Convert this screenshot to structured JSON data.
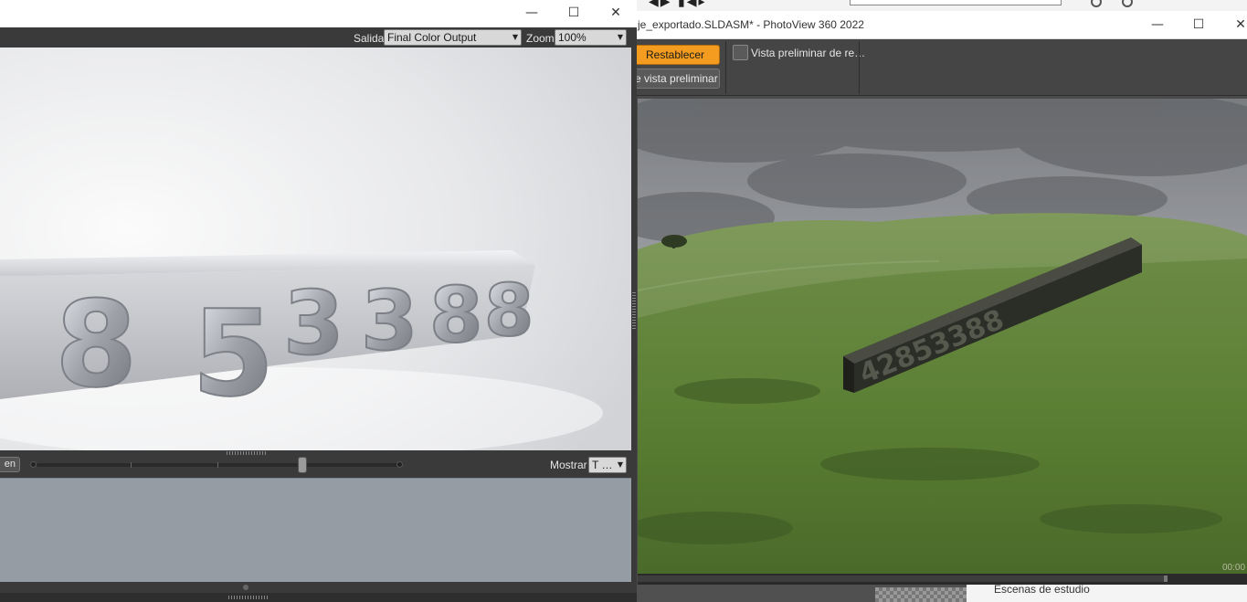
{
  "right_window": {
    "title": "je_exportado.SLDASM* - PhotoView 360 2022",
    "controls": {
      "minimize": "—",
      "maximize": "☐",
      "close": "✕"
    },
    "toolbar": {
      "reset_button": "Restablecer",
      "preview_button": "e vista preliminar",
      "preview_checkbox_label": "Vista preliminar de re…",
      "preview_checked": false,
      "accent_color": "#f39c1f"
    },
    "scene_digits": "42853388",
    "timecode": "00:00",
    "footer_label": "Escenas de estudio"
  },
  "left_window": {
    "controls": {
      "minimize": "—",
      "maximize": "☐",
      "close": "✕"
    },
    "toolbar": {
      "output_label": "Salida",
      "output_value": "Final Color Output",
      "zoom_label": "Zoom",
      "zoom_value": "100%"
    },
    "render_digits": [
      "8",
      "5",
      "3",
      "3",
      "8",
      "8"
    ],
    "controlbar": {
      "left_button": "en",
      "show_label": "Mostrar",
      "show_value": "T …",
      "slider_value": 0.73
    }
  }
}
